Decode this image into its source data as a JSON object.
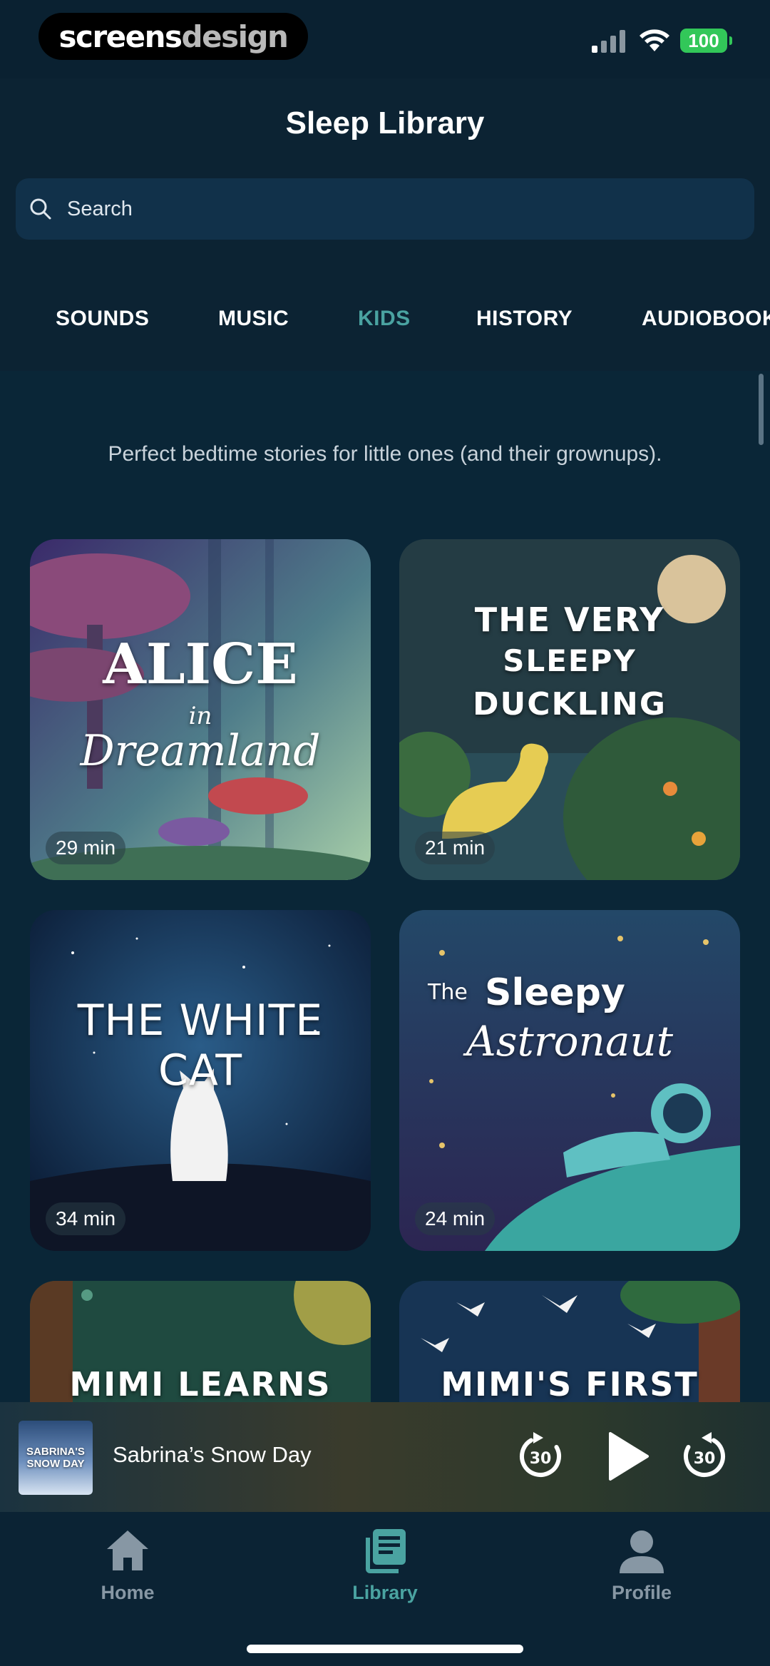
{
  "status_bar": {
    "watermark_bold": "screens",
    "watermark_light": "design",
    "battery": "100",
    "signal_icon": "cellular-signal-icon",
    "wifi_icon": "wifi-icon"
  },
  "header": {
    "title": "Sleep Library",
    "search_placeholder": "Search",
    "search_icon": "search-icon"
  },
  "tabs": [
    {
      "label": "SOUNDS",
      "active": false
    },
    {
      "label": "MUSIC",
      "active": false
    },
    {
      "label": "KIDS",
      "active": true
    },
    {
      "label": "HISTORY",
      "active": false
    },
    {
      "label": "AUDIOBOOKS",
      "active": false
    }
  ],
  "content": {
    "intro": "Perfect bedtime stories for little ones (and their grownups).",
    "cards": [
      {
        "title_line1": "ALICE",
        "title_line2": "in",
        "title_line3": "Dreamland",
        "duration": "29 min"
      },
      {
        "title_line1": "THE VERY",
        "title_line2": "SLEEPY",
        "title_line3": "DUCKLING",
        "duration": "21 min"
      },
      {
        "title_line1": "THE WHITE CAT",
        "duration": "34 min"
      },
      {
        "title_line1": "The",
        "title_line2": "Sleepy",
        "title_line3": "Astronaut",
        "duration": "24 min"
      },
      {
        "title_line1": "MIMI LEARNS"
      },
      {
        "title_line1": "MIMI'S FIRST"
      }
    ]
  },
  "player": {
    "thumb_text": "SABRINA'S SNOW DAY",
    "title": "Sabrina’s Snow Day",
    "skip_back": "30",
    "skip_forward": "30"
  },
  "bottom_nav": [
    {
      "label": "Home",
      "icon": "home-icon",
      "active": false
    },
    {
      "label": "Library",
      "icon": "library-icon",
      "active": true
    },
    {
      "label": "Profile",
      "icon": "profile-icon",
      "active": false
    }
  ],
  "colors": {
    "background": "#0a2131",
    "accent": "#4aa3a1",
    "search_bg": "#11314a",
    "battery": "#32c759"
  }
}
